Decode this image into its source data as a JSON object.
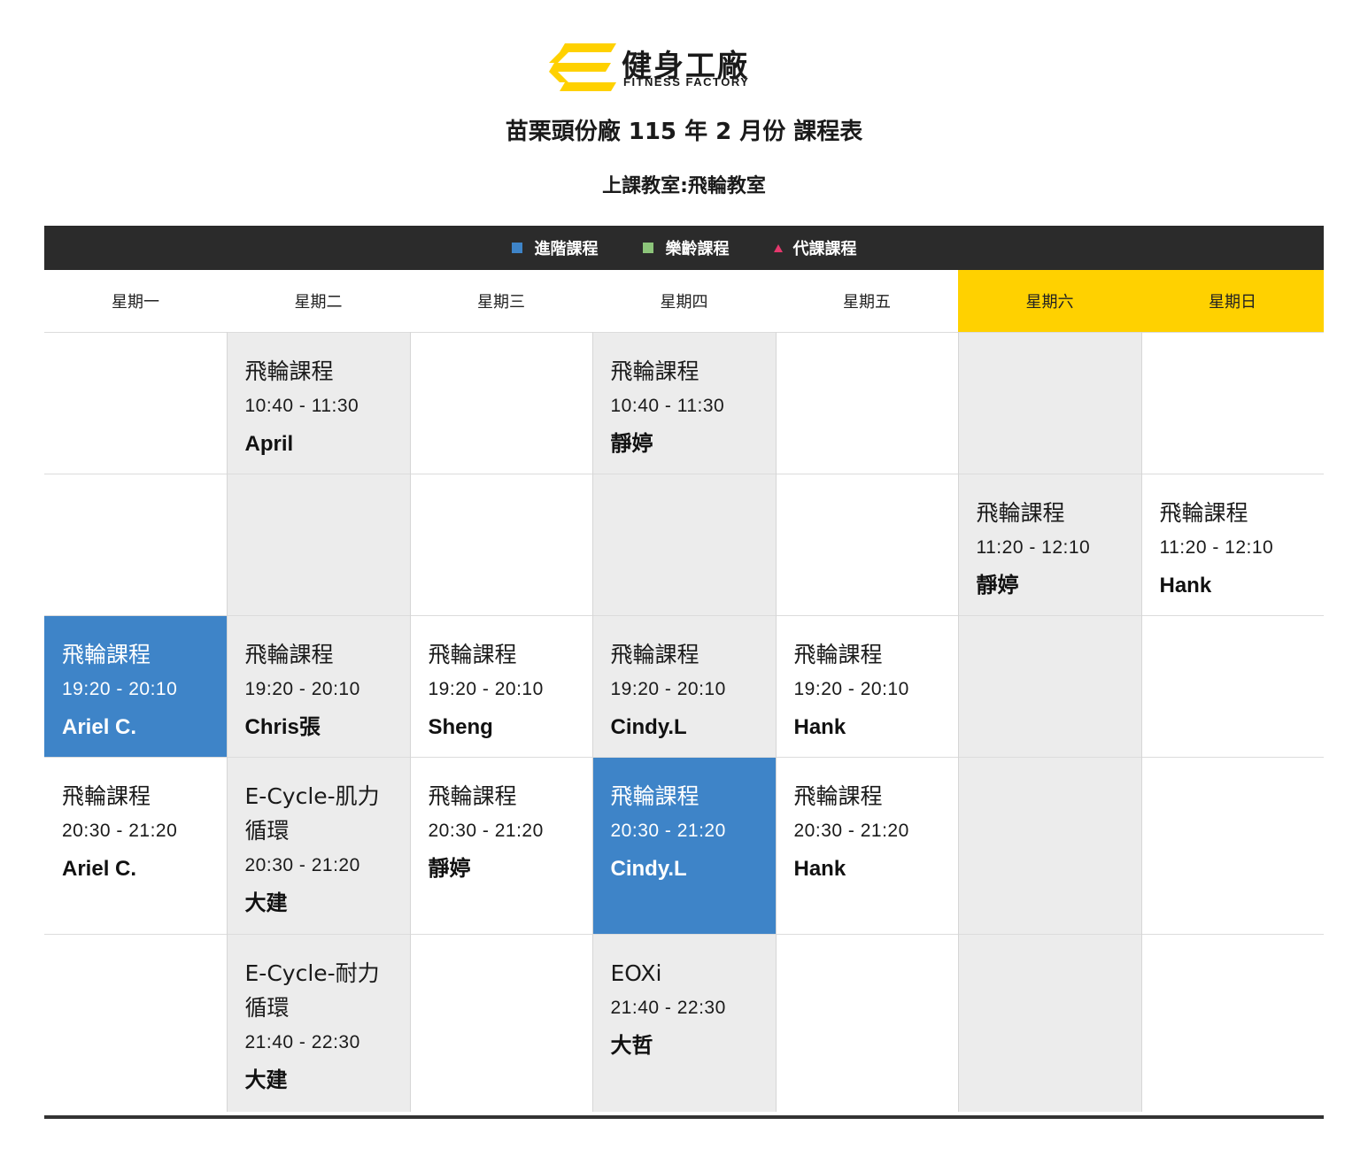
{
  "brand": {
    "name_cn": "健身工廠",
    "name_en": "FITNESS FACTORY",
    "logo_color": "#ffd100"
  },
  "header": {
    "title": "苗栗頭份廠 115 年 2 月份 課程表",
    "subtitle": "上課教室:飛輪教室"
  },
  "legend": {
    "items": [
      {
        "label": "進階課程",
        "color": "#3e84c8",
        "shape": "square"
      },
      {
        "label": "樂齡課程",
        "color": "#8cc47a",
        "shape": "square"
      },
      {
        "label": "代課課程",
        "color": "#e5386d",
        "shape": "triangle"
      }
    ]
  },
  "days": [
    "星期一",
    "星期二",
    "星期三",
    "星期四",
    "星期五",
    "星期六",
    "星期日"
  ],
  "colors": {
    "weekend_header": "#ffd100",
    "advanced": "#3e84c8",
    "grey_column": "#ececec"
  },
  "schedule": {
    "r1": {
      "tue": {
        "name": "飛輪課程",
        "time": "10:40 - 11:30",
        "teacher": "April"
      },
      "thu": {
        "name": "飛輪課程",
        "time": "10:40 - 11:30",
        "teacher": "靜婷"
      }
    },
    "r2": {
      "sat": {
        "name": "飛輪課程",
        "time": "11:20 - 12:10",
        "teacher": "靜婷"
      },
      "sun": {
        "name": "飛輪課程",
        "time": "11:20 - 12:10",
        "teacher": "Hank"
      }
    },
    "r3": {
      "mon": {
        "name": "飛輪課程",
        "time": "19:20 - 20:10",
        "teacher": "Ariel C.",
        "type": "進階課程"
      },
      "tue": {
        "name": "飛輪課程",
        "time": "19:20 - 20:10",
        "teacher": "Chris張"
      },
      "wed": {
        "name": "飛輪課程",
        "time": "19:20 - 20:10",
        "teacher": "Sheng"
      },
      "thu": {
        "name": "飛輪課程",
        "time": "19:20 - 20:10",
        "teacher": "Cindy.L"
      },
      "fri": {
        "name": "飛輪課程",
        "time": "19:20 - 20:10",
        "teacher": "Hank"
      }
    },
    "r4": {
      "mon": {
        "name": "飛輪課程",
        "time": "20:30 - 21:20",
        "teacher": "Ariel C."
      },
      "tue": {
        "name": "E-Cycle-肌力循環",
        "time": "20:30 - 21:20",
        "teacher": "大建"
      },
      "wed": {
        "name": "飛輪課程",
        "time": "20:30 - 21:20",
        "teacher": "靜婷"
      },
      "thu": {
        "name": "飛輪課程",
        "time": "20:30 - 21:20",
        "teacher": "Cindy.L",
        "type": "進階課程"
      },
      "fri": {
        "name": "飛輪課程",
        "time": "20:30 - 21:20",
        "teacher": "Hank"
      }
    },
    "r5": {
      "tue": {
        "name": "E-Cycle-耐力循環",
        "time": "21:40 - 22:30",
        "teacher": "大建"
      },
      "thu": {
        "name": "EOXi",
        "time": "21:40 - 22:30",
        "teacher": "大哲"
      }
    }
  }
}
